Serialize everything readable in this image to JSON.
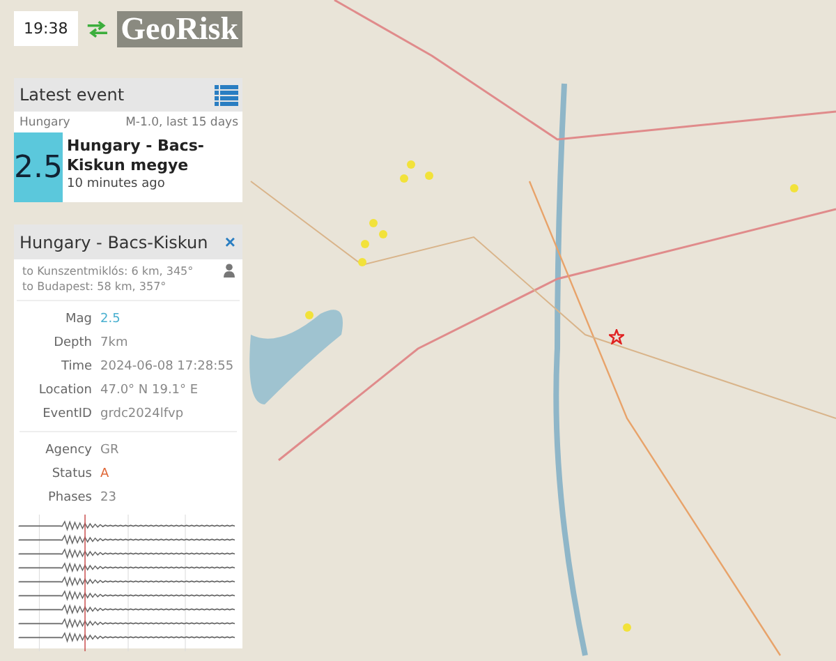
{
  "clock": {
    "time": "19:38"
  },
  "logo": {
    "text": "GeoRisk"
  },
  "latest_event": {
    "title": "Latest event",
    "region": "Hungary",
    "filter": "M-1.0, last 15 days",
    "magnitude": "2.5",
    "place": "Hungary - Bacs-Kiskun megye",
    "age": "10 minutes ago"
  },
  "event_detail": {
    "title": "Hungary - Bacs-Kiskun",
    "close": "×",
    "distances": [
      "to Kunszentmiklós: 6 km, 345°",
      "to Budapest: 58 km, 357°"
    ],
    "fields": [
      {
        "label": "Mag",
        "value": "2.5",
        "kind": "highlight"
      },
      {
        "label": "Depth",
        "value": "7km",
        "kind": "plain"
      },
      {
        "label": "Time",
        "value": "2024-06-08 17:28:55",
        "kind": "plain"
      },
      {
        "label": "Location",
        "value": "47.0° N 19.1° E",
        "kind": "plain"
      },
      {
        "label": "EventID",
        "value": "grdc2024lfvp",
        "kind": "plain"
      }
    ],
    "fields_2": [
      {
        "label": "Agency",
        "value": "GR",
        "kind": "plain"
      },
      {
        "label": "Status",
        "value": "A",
        "kind": "status"
      },
      {
        "label": "Phases",
        "value": "23",
        "kind": "plain"
      }
    ]
  }
}
